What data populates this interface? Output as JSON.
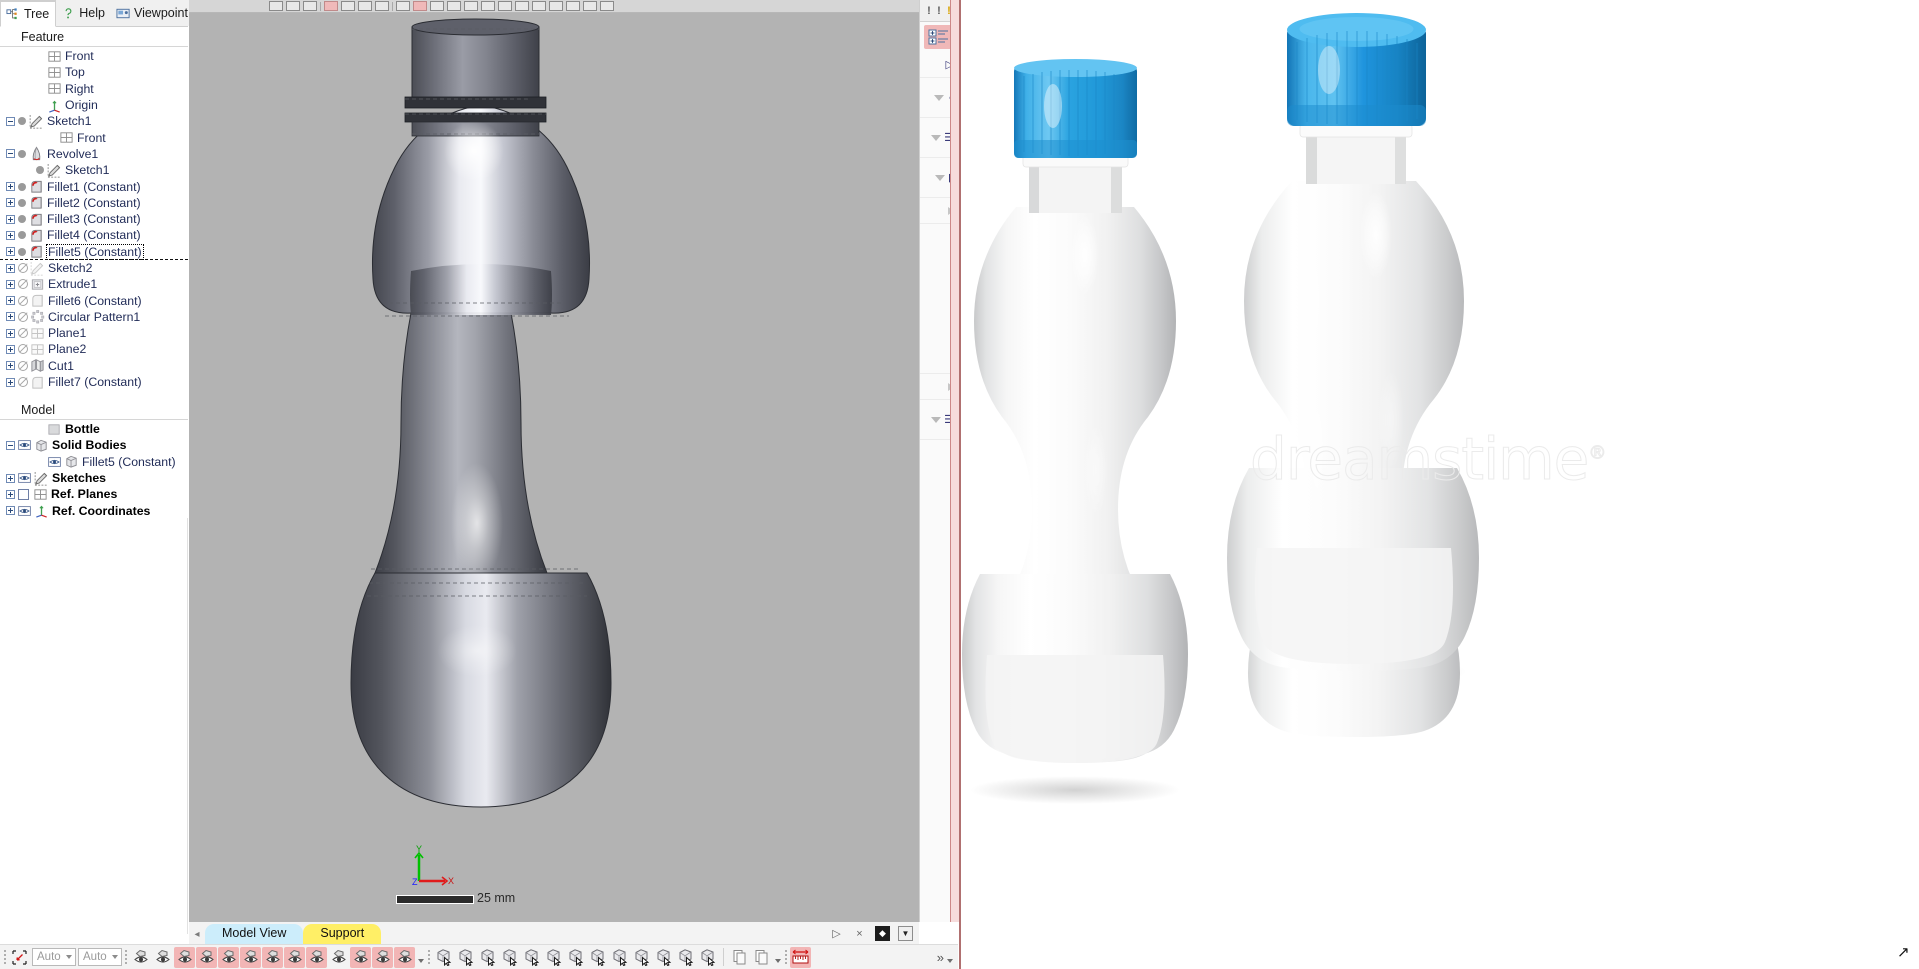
{
  "window": {
    "tabs": [
      {
        "label": "Tree",
        "icon": "tree-icon",
        "active": true
      },
      {
        "label": "Help",
        "icon": "help-icon",
        "active": false
      },
      {
        "label": "Viewpoint",
        "icon": "viewpoint-icon",
        "active": false
      }
    ]
  },
  "feature_panel": {
    "header": "Feature",
    "nodes": [
      {
        "label": "Front",
        "icon": "plane-icon",
        "expander": "none",
        "marker": "none",
        "indent": 1,
        "selected": false,
        "bold": false
      },
      {
        "label": "Top",
        "icon": "plane-icon",
        "expander": "none",
        "marker": "none",
        "indent": 1,
        "selected": false,
        "bold": false
      },
      {
        "label": "Right",
        "icon": "plane-icon",
        "expander": "none",
        "marker": "none",
        "indent": 1,
        "selected": false,
        "bold": false
      },
      {
        "label": "Origin",
        "icon": "origin-icon",
        "expander": "none",
        "marker": "none",
        "indent": 1,
        "selected": false,
        "bold": false
      },
      {
        "label": "Sketch1",
        "icon": "sketch-icon",
        "expander": "minus",
        "marker": "dot",
        "indent": 0,
        "selected": false,
        "bold": false
      },
      {
        "label": "Front",
        "icon": "plane-icon",
        "expander": "none",
        "marker": "none",
        "indent": 2,
        "selected": false,
        "bold": false
      },
      {
        "label": "Revolve1",
        "icon": "revolve-icon",
        "expander": "minus",
        "marker": "dot",
        "indent": 0,
        "selected": false,
        "bold": false
      },
      {
        "label": "Sketch1",
        "icon": "sketch-icon",
        "expander": "none",
        "marker": "dot",
        "indent": 1,
        "selected": false,
        "bold": false
      },
      {
        "label": "Fillet1 (Constant)",
        "icon": "fillet-icon",
        "expander": "plus",
        "marker": "dot",
        "indent": 0,
        "selected": false,
        "bold": false
      },
      {
        "label": "Fillet2 (Constant)",
        "icon": "fillet-icon",
        "expander": "plus",
        "marker": "dot",
        "indent": 0,
        "selected": false,
        "bold": false
      },
      {
        "label": "Fillet3 (Constant)",
        "icon": "fillet-icon",
        "expander": "plus",
        "marker": "dot",
        "indent": 0,
        "selected": false,
        "bold": false
      },
      {
        "label": "Fillet4 (Constant)",
        "icon": "fillet-icon",
        "expander": "plus",
        "marker": "dot",
        "indent": 0,
        "selected": false,
        "bold": false
      },
      {
        "label": "Fillet5 (Constant)",
        "icon": "fillet-icon",
        "expander": "plus",
        "marker": "dot",
        "indent": 0,
        "selected": true,
        "bold": false
      },
      {
        "label": "Sketch2",
        "icon": "sketch-gray-icon",
        "expander": "plus",
        "marker": "suppressed",
        "indent": 0,
        "selected": false,
        "bold": false
      },
      {
        "label": "Extrude1",
        "icon": "extrude-icon",
        "expander": "plus",
        "marker": "suppressed",
        "indent": 0,
        "selected": false,
        "bold": false
      },
      {
        "label": "Fillet6 (Constant)",
        "icon": "fillet-gray-icon",
        "expander": "plus",
        "marker": "suppressed",
        "indent": 0,
        "selected": false,
        "bold": false
      },
      {
        "label": "Circular Pattern1",
        "icon": "circular-pattern-icon",
        "expander": "plus",
        "marker": "suppressed",
        "indent": 0,
        "selected": false,
        "bold": false
      },
      {
        "label": "Plane1",
        "icon": "plane-gray-icon",
        "expander": "plus",
        "marker": "suppressed",
        "indent": 0,
        "selected": false,
        "bold": false
      },
      {
        "label": "Plane2",
        "icon": "plane-gray-icon",
        "expander": "plus",
        "marker": "suppressed",
        "indent": 0,
        "selected": false,
        "bold": false
      },
      {
        "label": "Cut1",
        "icon": "cut-icon",
        "expander": "plus",
        "marker": "suppressed",
        "indent": 0,
        "selected": false,
        "bold": false
      },
      {
        "label": "Fillet7 (Constant)",
        "icon": "fillet-gray-icon",
        "expander": "plus",
        "marker": "suppressed",
        "indent": 0,
        "selected": false,
        "bold": false
      }
    ],
    "rollback_after_index": 12
  },
  "model_panel": {
    "header": "Model",
    "nodes": [
      {
        "label": "Bottle",
        "icon": "part-icon",
        "expander": "none",
        "marker": "none",
        "indent": 1,
        "bold": true
      },
      {
        "label": "Solid Bodies",
        "icon": "body-icon",
        "expander": "minus",
        "marker": "eye",
        "indent": 0,
        "bold": true
      },
      {
        "label": "Fillet5 (Constant)",
        "icon": "body-icon",
        "expander": "none",
        "marker": "eye",
        "indent": 2,
        "bold": false
      },
      {
        "label": "Sketches",
        "icon": "sketch-icon",
        "expander": "plus",
        "marker": "eye",
        "indent": 0,
        "bold": true
      },
      {
        "label": "Ref. Planes",
        "icon": "plane-icon",
        "expander": "plus",
        "marker": "checkbox",
        "indent": 0,
        "bold": true
      },
      {
        "label": "Ref. Coordinates",
        "icon": "origin-icon",
        "expander": "plus",
        "marker": "eye",
        "indent": 0,
        "bold": true
      }
    ]
  },
  "viewport": {
    "scale_label": "25 mm",
    "triad": {
      "x_label": "X",
      "y_label": "Y",
      "z_label": "Z",
      "x_color": "#e01b1b",
      "y_color": "#00c000",
      "z_color": "#1a1aff"
    },
    "background_color": "#b3b3b3"
  },
  "view_tabs": [
    {
      "label": "Model View",
      "color": "#ccedfb",
      "active": true
    },
    {
      "label": "Support",
      "color": "#ffef66",
      "active": false
    }
  ],
  "view_tab_controls": [
    {
      "name": "play-icon",
      "glyph": "▷"
    },
    {
      "name": "close-icon",
      "glyph": "×"
    },
    {
      "name": "next-icon",
      "glyph": "◆"
    },
    {
      "name": "dropdown-icon",
      "glyph": "▼"
    }
  ],
  "bottom_toolbar": {
    "selection_filter_icon": "selection-filter-icon",
    "combos": [
      {
        "name": "filter-mode-combo",
        "value": "Auto"
      },
      {
        "name": "filter-scope-combo",
        "value": "Auto"
      }
    ],
    "group1": [
      {
        "name": "shaded-view-icon",
        "active": false
      },
      {
        "name": "shaded-globe-view-icon",
        "active": false
      },
      {
        "name": "show-all-points-icon",
        "active": true
      },
      {
        "name": "show-faces-icon",
        "active": true
      },
      {
        "name": "show-solids-icon",
        "active": true
      },
      {
        "name": "show-sketch-icon",
        "active": true
      },
      {
        "name": "show-sketch-active-icon",
        "active": true
      },
      {
        "name": "show-points-icon",
        "active": true
      },
      {
        "name": "show-curves-icon",
        "active": true
      },
      {
        "name": "show-planes-icon",
        "active": false
      },
      {
        "name": "show-axes-icon",
        "active": true
      },
      {
        "name": "show-coordinates-icon",
        "active": true
      },
      {
        "name": "show-dimensions-icon",
        "active": true
      }
    ],
    "group2": [
      {
        "name": "select-solid-icon"
      },
      {
        "name": "select-globe-icon"
      },
      {
        "name": "select-face-icon"
      },
      {
        "name": "select-edge-vertex-icon"
      },
      {
        "name": "select-loop-icon"
      },
      {
        "name": "select-body-icon"
      },
      {
        "name": "select-top-face-icon"
      },
      {
        "name": "select-top-edge-icon"
      },
      {
        "name": "select-side-face-icon"
      },
      {
        "name": "select-vertex-icon"
      },
      {
        "name": "select-plane-icon"
      },
      {
        "name": "select-sketch-icon"
      },
      {
        "name": "select-dimension-icon"
      }
    ],
    "group3": [
      {
        "name": "copy-icon"
      },
      {
        "name": "measure-ruler-icon"
      }
    ],
    "overflow_label": "»"
  },
  "right_strip": {
    "warning_glyphs": [
      "!",
      "!",
      "!"
    ],
    "selected_tool": "tree-add-icon"
  },
  "render_image": {
    "watermark": "dreamstime",
    "watermark_mark": "®",
    "bottles": [
      {
        "name": "bottle-front-view",
        "cap_color": "#2aa3e0",
        "body_color": "#f7f7f7"
      },
      {
        "name": "bottle-angled-view",
        "cap_color": "#1f94dd",
        "body_color": "#fbfbfb"
      }
    ]
  }
}
